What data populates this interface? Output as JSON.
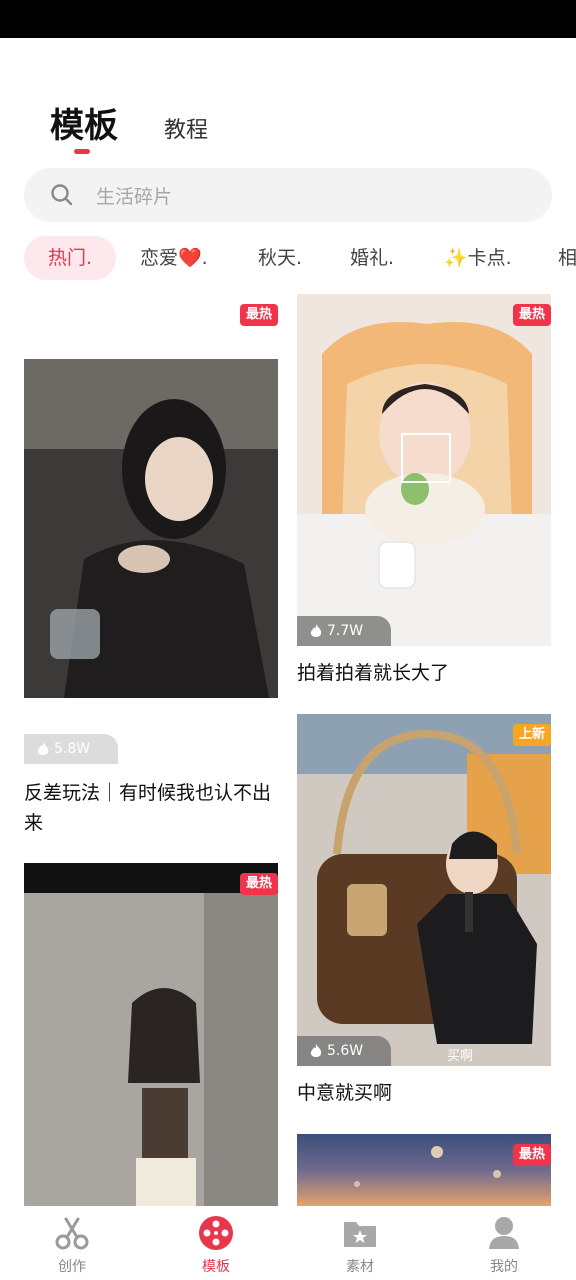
{
  "top_tabs": {
    "active": "模板",
    "other": "教程"
  },
  "search": {
    "placeholder": "生活碎片"
  },
  "chips": [
    "热门.",
    "恋爱❤️.",
    "秋天.",
    "婚礼.",
    "✨卡点.",
    "相"
  ],
  "cards": [
    {
      "badge": "最热",
      "views": "5.8W",
      "title": "反差玩法｜有时候我也认不出来"
    },
    {
      "badge": "最热",
      "views": "7.7W",
      "title": "拍着拍着就长大了"
    },
    {
      "badge": "上新",
      "views": "5.6W",
      "title": "中意就买啊",
      "overlay_text": "买啊"
    },
    {
      "badge": "最热"
    },
    {
      "badge": "最热"
    }
  ],
  "bottom_nav": [
    {
      "label": "创作",
      "icon": "scissors-icon"
    },
    {
      "label": "模板",
      "icon": "film-reel-icon",
      "active": true
    },
    {
      "label": "素材",
      "icon": "folder-star-icon"
    },
    {
      "label": "我的",
      "icon": "person-icon"
    }
  ],
  "colors": {
    "accent": "#e8364a",
    "badge_hot": "#f1344a",
    "badge_new": "#f6a623"
  }
}
